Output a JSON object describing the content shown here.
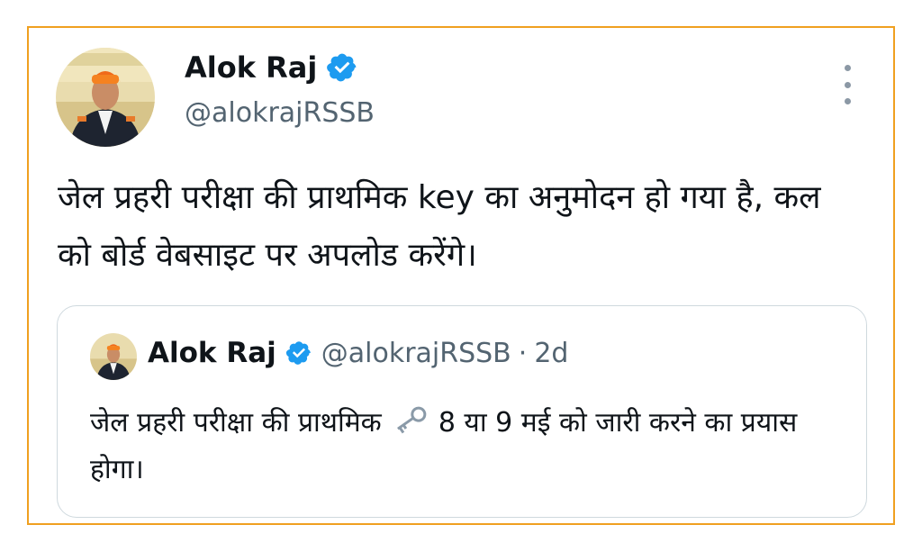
{
  "tweet": {
    "author_name": "Alok Raj",
    "author_handle": "@alokrajRSSB",
    "text": "जेल प्रहरी परीक्षा की प्राथमिक key का अनुमोदन हो गया है, कल को बोर्ड वेबसाइट पर अपलोड करेंगे।",
    "icons": [
      "verified-badge-icon",
      "more-options-icon"
    ]
  },
  "quoted_tweet": {
    "author_name": "Alok Raj",
    "author_handle": "@alokrajRSSB",
    "separator": "·",
    "time": "2d",
    "text_before_emoji": "जेल प्रहरी परीक्षा की प्राथमिक",
    "emoji": "old-key-icon",
    "text_after_emoji": "8 या 9 मई को जारी करने का प्रयास होगा।"
  },
  "colors": {
    "frame_border": "#f0a020",
    "verified_blue": "#1d9bf0",
    "secondary_text": "#536471",
    "quote_border": "#cfd9de"
  }
}
